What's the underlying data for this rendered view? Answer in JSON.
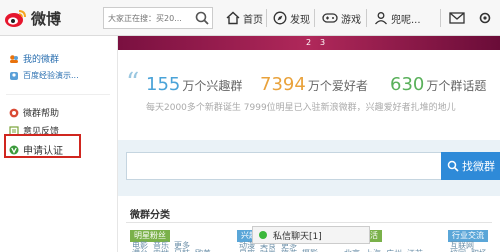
{
  "header": {
    "logo_text": "微博",
    "search_placeholder": "大家正在搜：买20...",
    "nav": [
      {
        "label": "首页",
        "icon": "home-icon"
      },
      {
        "label": "发现",
        "icon": "compass-icon"
      },
      {
        "label": "游戏",
        "icon": "gamepad-icon"
      },
      {
        "label": "兜呢...",
        "icon": "user-icon"
      }
    ]
  },
  "sidebar": {
    "items": [
      {
        "label": "我的微群",
        "icon": "group-icon",
        "color": "#e8720c"
      },
      {
        "label": "百度经验演示...",
        "icon": "group-small-icon",
        "color": "#5aa0d8"
      },
      {
        "label": "微群帮助",
        "icon": "help-icon",
        "color": "#d94a35"
      },
      {
        "label": "意见反馈",
        "icon": "feedback-icon",
        "color": "#7aa33a"
      },
      {
        "label": "申请认证",
        "icon": "verify-icon",
        "color": "#3b9a3b"
      }
    ]
  },
  "banner": {
    "pager": [
      "2",
      "3"
    ]
  },
  "stats": {
    "items": [
      {
        "num": "155",
        "unit": "万个兴趣群",
        "color": "#4aa3d8"
      },
      {
        "num": "7394",
        "unit": "万个爱好者",
        "color": "#e9a23b"
      },
      {
        "num": "630",
        "unit": "万个群话题",
        "color": "#59b05a"
      }
    ],
    "subtitle": "每天2000多个新群诞生   7999位明星已入驻新浪微群，兴趣爱好者扎堆的地儿"
  },
  "search": {
    "button_label": "找微群"
  },
  "categories": {
    "title": "微群分类",
    "groups": [
      {
        "tag": "明星粉丝",
        "color": "#7ab14a",
        "row1": [
          "港台",
          "内地",
          "日韩",
          "欧美"
        ],
        "row2": [
          "电影",
          "音乐",
          "更多"
        ]
      },
      {
        "tag": "兴趣爱好",
        "color": "#5aa6d8",
        "row1": [
          "星座",
          "时尚",
          "旅游",
          "摄影"
        ],
        "row2": [
          "动漫",
          "美食",
          "更多"
        ]
      },
      {
        "tag": "同城生活",
        "color": "#7ab14a",
        "row1": [
          "北京",
          "上海",
          "广州",
          "江苏"
        ],
        "row2": [
          "山东",
          "湖北",
          "四川"
        ]
      },
      {
        "tag": "行业交流",
        "color": "#5aa6d8",
        "row1": [
          "校园",
          "职场"
        ],
        "row2": [
          "互联网",
          "传媒"
        ]
      }
    ]
  },
  "chat": {
    "label": "私信聊天[1]"
  }
}
